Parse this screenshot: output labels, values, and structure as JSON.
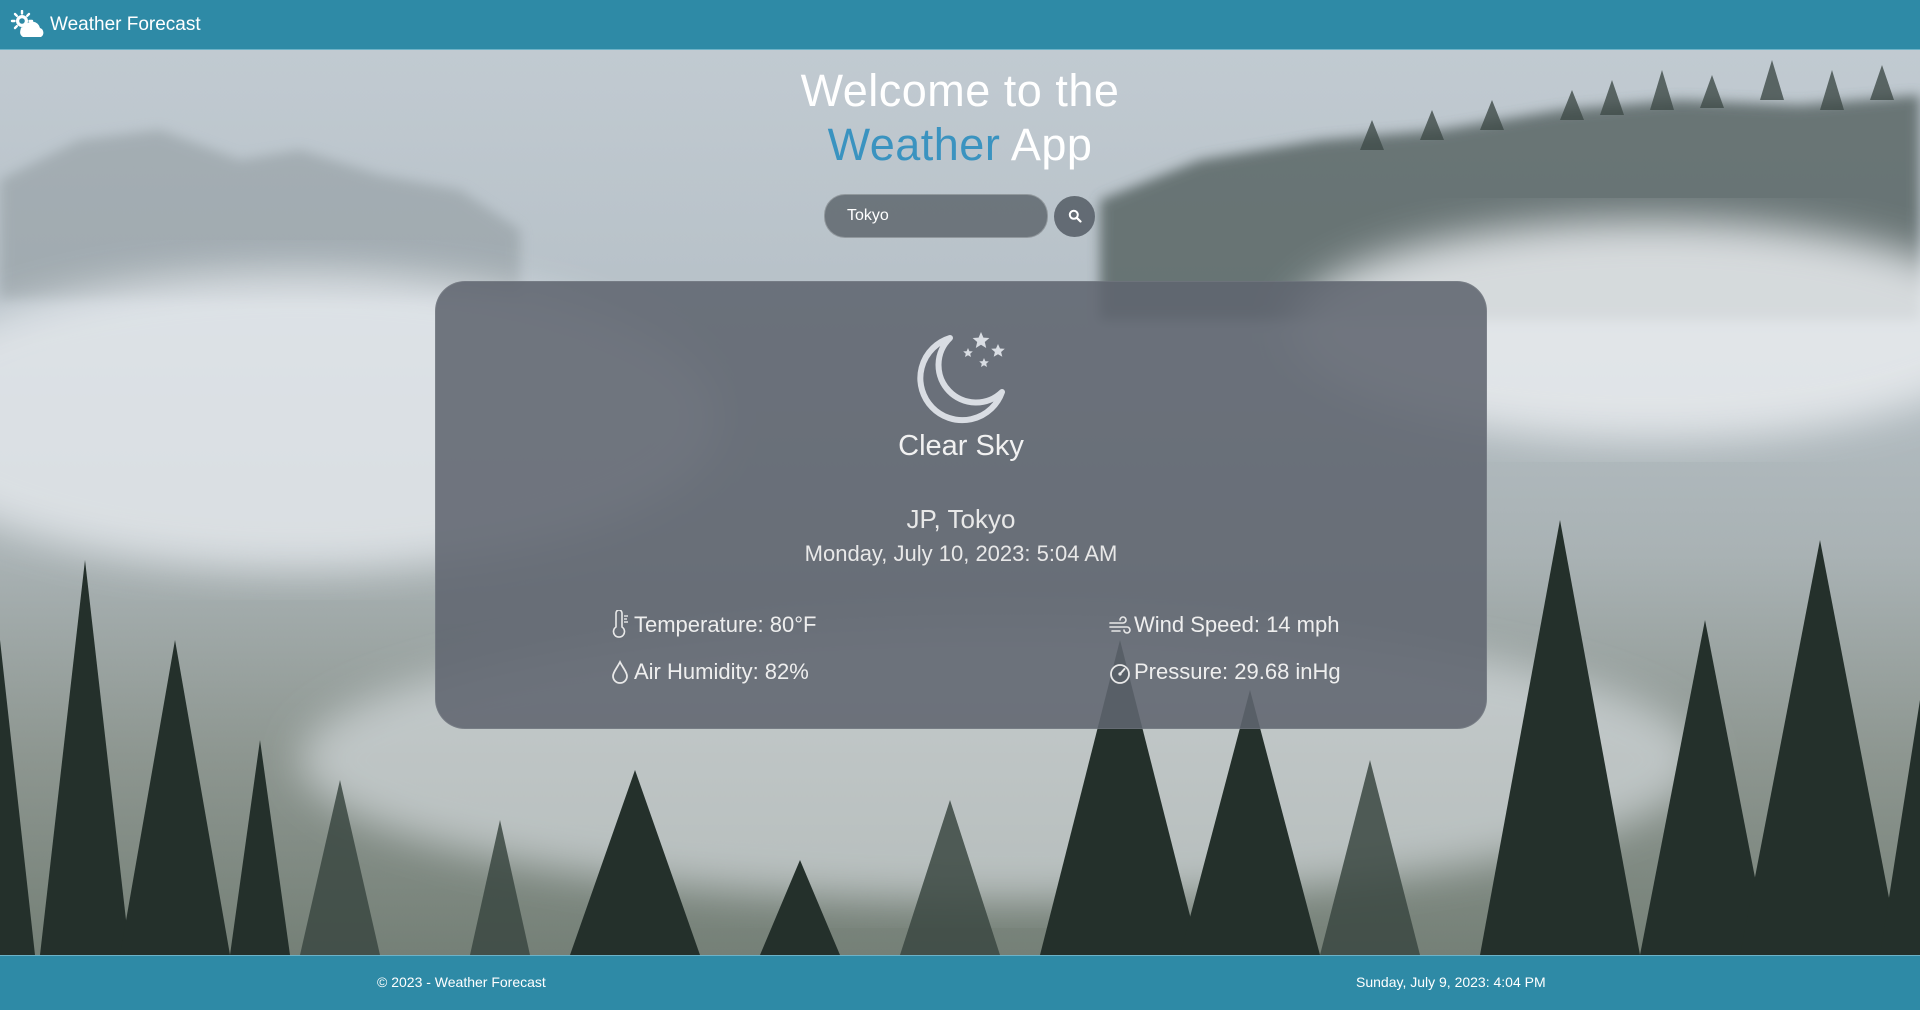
{
  "app": {
    "title": "Weather Forecast"
  },
  "hero": {
    "line1": "Welcome to the",
    "accent_word": "Weather",
    "line2_rest": " App"
  },
  "search": {
    "value": "Tokyo",
    "button_icon": "search-icon"
  },
  "weather": {
    "condition": "Clear Sky",
    "condition_icon": "moon-stars-icon",
    "location": "JP, Tokyo",
    "local_datetime": "Monday, July 10, 2023: 5:04 AM",
    "stats": {
      "temperature": "Temperature: 80°F",
      "humidity": "Air Humidity: 82%",
      "wind": "Wind Speed: 14 mph",
      "pressure": "Pressure: 29.68 inHg"
    }
  },
  "footer": {
    "copyright": "© 2023 - Weather Forecast",
    "current_date": "Sunday, July 9, 2023: 4:04 PM"
  },
  "colors": {
    "navbar": "#2e8aa6",
    "accent": "#3a93c0",
    "card": "#60656f"
  }
}
